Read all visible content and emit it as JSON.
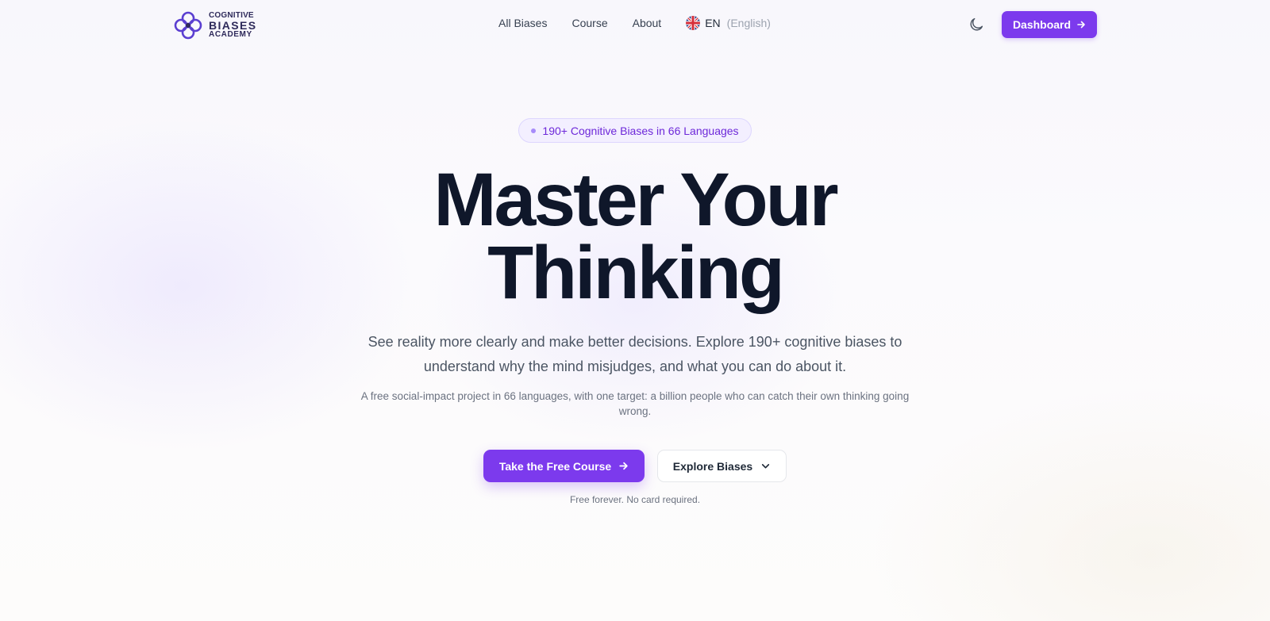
{
  "brand": {
    "line1": "COGNITIVE",
    "line2": "BIASES",
    "line3": "ACADEMY",
    "accent": "#7c3aed",
    "logo_color": "#2e2a5a"
  },
  "nav": {
    "links": [
      "All Biases",
      "Course",
      "About"
    ],
    "language": {
      "code": "EN",
      "name": "(English)",
      "flag_icon": "uk-flag-icon"
    },
    "theme_icon": "moon-icon",
    "dashboard_label": "Dashboard",
    "dashboard_icon": "arrow-right-icon"
  },
  "hero": {
    "badge": "190+ Cognitive Biases in 66 Languages",
    "headline_line1": "Master Your",
    "headline_line2": "Thinking",
    "subtitle": "See reality more clearly and make better decisions. Explore 190+ cognitive biases to understand why the mind misjudges, and what you can do about it.",
    "note": "A free social-impact project in 66 languages, with one target: a billion people who can catch their own thinking going wrong.",
    "primary_cta": "Take the Free Course",
    "secondary_cta": "Explore Biases",
    "secondary_icon": "chevron-down-icon",
    "footnote": "Free forever. No card required."
  }
}
